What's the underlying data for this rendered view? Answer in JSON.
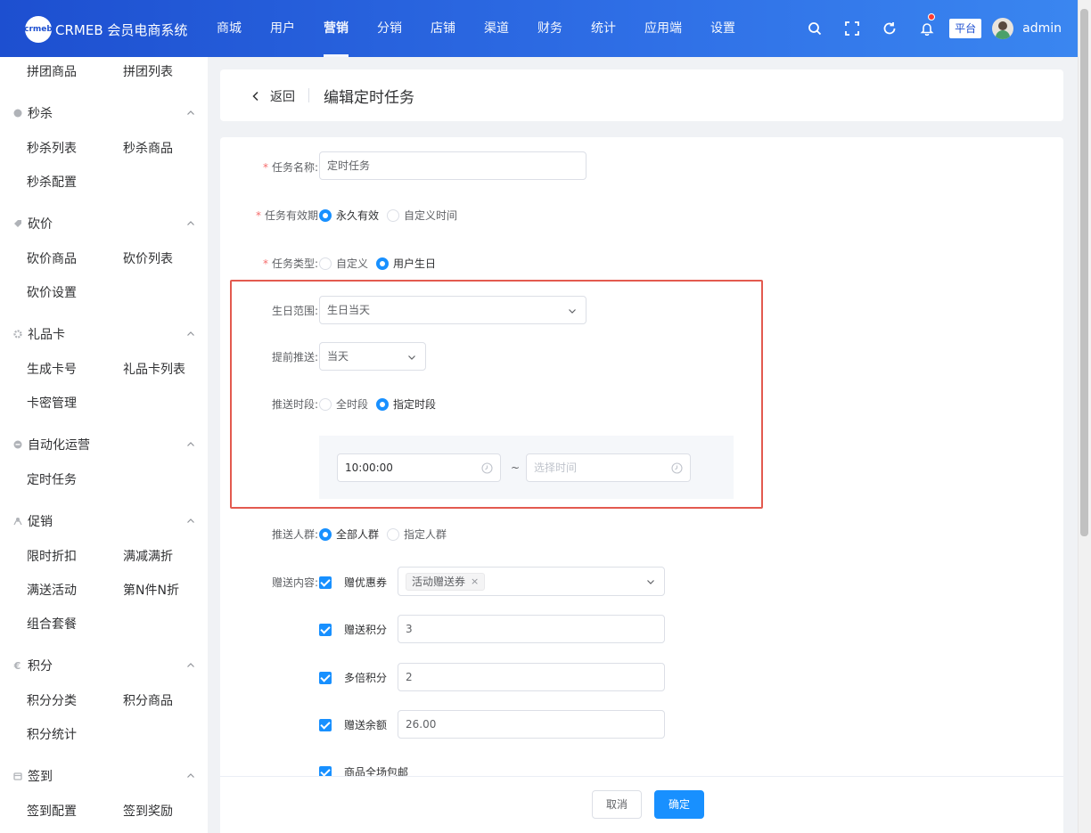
{
  "app": {
    "brand_badge": "crmeb",
    "brand_text": "CRMEB 会员电商系统"
  },
  "nav": {
    "items": [
      {
        "label": "商城"
      },
      {
        "label": "用户"
      },
      {
        "label": "营销"
      },
      {
        "label": "分销"
      },
      {
        "label": "店铺"
      },
      {
        "label": "渠道"
      },
      {
        "label": "财务"
      },
      {
        "label": "统计"
      },
      {
        "label": "应用端"
      },
      {
        "label": "设置"
      }
    ],
    "active": "营销"
  },
  "toolbar": {
    "platform": "平台",
    "user": "admin"
  },
  "sidebar": {
    "top_items": [
      "拼团商品",
      "拼团列表"
    ],
    "groups": [
      {
        "title": "秒杀",
        "icon": "circle-icon",
        "items": [
          "秒杀列表",
          "秒杀商品",
          "秒杀配置"
        ]
      },
      {
        "title": "砍价",
        "icon": "tag-icon",
        "items": [
          "砍价商品",
          "砍价列表",
          "砍价设置"
        ]
      },
      {
        "title": "礼品卡",
        "icon": "gear-icon",
        "items": [
          "生成卡号",
          "礼品卡列表",
          "卡密管理"
        ]
      },
      {
        "title": "自动化运营",
        "icon": "robot-icon",
        "items": [
          "定时任务"
        ]
      },
      {
        "title": "促销",
        "icon": "promo-icon",
        "items": [
          "限时折扣",
          "满减满折",
          "满送活动",
          "第N件N折",
          "组合套餐"
        ]
      },
      {
        "title": "积分",
        "icon": "euro-icon",
        "items": [
          "积分分类",
          "积分商品",
          "积分统计"
        ]
      },
      {
        "title": "签到",
        "icon": "calendar-icon",
        "items": [
          "签到配置",
          "签到奖励"
        ]
      }
    ]
  },
  "header": {
    "back_label": "返回",
    "title": "编辑定时任务"
  },
  "form": {
    "task_name": {
      "label": "任务名称:",
      "value": "定时任务"
    },
    "validity": {
      "label": "任务有效期",
      "options": [
        "永久有效",
        "自定义时间"
      ],
      "selected": "永久有效"
    },
    "task_type": {
      "label": "任务类型:",
      "options": [
        "自定义",
        "用户生日"
      ],
      "selected": "用户生日"
    },
    "birthday_range": {
      "label": "生日范围:",
      "value": "生日当天"
    },
    "advance_push": {
      "label": "提前推送:",
      "value": "当天"
    },
    "push_period": {
      "label": "推送时段:",
      "options": [
        "全时段",
        "指定时段"
      ],
      "selected": "指定时段"
    },
    "time_range": {
      "start": "10:00:00",
      "end_placeholder": "选择时间",
      "separator": "~"
    },
    "push_crowd": {
      "label": "推送人群:",
      "options": [
        "全部人群",
        "指定人群"
      ],
      "selected": "全部人群"
    },
    "gift_content": {
      "label": "赠送内容:",
      "coupon": {
        "label": "赠优惠券",
        "tag": "活动赠送券",
        "tag_close": "×"
      },
      "points": {
        "label": "赠送积分",
        "value": "3"
      },
      "multiplier": {
        "label": "多倍积分",
        "value": "2"
      },
      "balance": {
        "label": "赠送余额",
        "value": "26.00"
      },
      "free_shipping": {
        "label": "商品全场包邮"
      }
    }
  },
  "footer": {
    "cancel_label": "取消",
    "confirm_label": "确定"
  },
  "colors": {
    "primary": "#1890ff",
    "topbar": "#2f6fe6",
    "highlight_border": "#e35a4f",
    "required": "#f56c6c"
  }
}
